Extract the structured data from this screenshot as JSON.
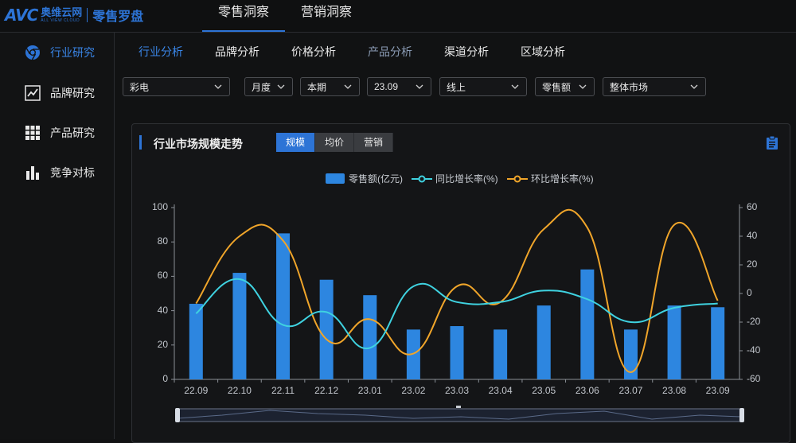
{
  "brand": {
    "mark": "AVC",
    "name_cn": "奥维云网",
    "name_en": "ALL VIEW CLOUD",
    "product": "零售罗盘"
  },
  "topnav": [
    {
      "label": "零售洞察",
      "active": true
    },
    {
      "label": "营销洞察",
      "active": false
    }
  ],
  "sidebar": [
    {
      "label": "行业研究",
      "icon": "chrome-like-icon",
      "active": true
    },
    {
      "label": "品牌研究",
      "icon": "trend-chart-icon",
      "active": false
    },
    {
      "label": "产品研究",
      "icon": "grid-icon",
      "active": false
    },
    {
      "label": "竞争对标",
      "icon": "bar-chart-icon",
      "active": false
    }
  ],
  "subtabs": [
    "行业分析",
    "品牌分析",
    "价格分析",
    "产品分析",
    "渠道分析",
    "区域分析"
  ],
  "filters": {
    "category": "彩电",
    "period_type": "月度",
    "period": "本期",
    "month": "23.09",
    "channel": "线上",
    "metric": "零售额",
    "market": "整体市场"
  },
  "panel": {
    "title": "行业市场规模走势",
    "buttons": [
      {
        "label": "规模",
        "active": true
      },
      {
        "label": "均价",
        "active": false
      },
      {
        "label": "营销",
        "active": false
      }
    ]
  },
  "colors": {
    "accent": "#2d74d6",
    "bar": "#2d86e0",
    "yoy": "#3fd2e0",
    "mom": "#f0a52a"
  },
  "chart_data": {
    "type": "bar",
    "categories": [
      "22.09",
      "22.10",
      "22.11",
      "22.12",
      "23.01",
      "23.02",
      "23.03",
      "23.04",
      "23.05",
      "23.06",
      "23.07",
      "23.08",
      "23.09"
    ],
    "series": [
      {
        "name": "零售额(亿元)",
        "type": "bar",
        "axis": "left",
        "values": [
          44,
          62,
          85,
          58,
          49,
          29,
          31,
          29,
          43,
          64,
          29,
          43,
          42
        ]
      },
      {
        "name": "同比增长率(%)",
        "type": "line",
        "axis": "right",
        "values": [
          -14,
          10,
          -22,
          -13,
          -38,
          5,
          -6,
          -6,
          2,
          -4,
          -20,
          -10,
          -7
        ]
      },
      {
        "name": "环比增长率(%)",
        "type": "line",
        "axis": "right",
        "values": [
          -7,
          40,
          37,
          -32,
          -18,
          -42,
          5,
          -6,
          45,
          46,
          -55,
          48,
          -5
        ]
      }
    ],
    "ylim_left": [
      0,
      100
    ],
    "yticks_left": [
      "0",
      "20",
      "40",
      "60",
      "80",
      "100"
    ],
    "ylim_right": [
      -60,
      60
    ],
    "yticks_right": [
      "-60",
      "-40",
      "-20",
      "0",
      "20",
      "40",
      "60"
    ],
    "legend_position": "top-center",
    "grid": false
  }
}
